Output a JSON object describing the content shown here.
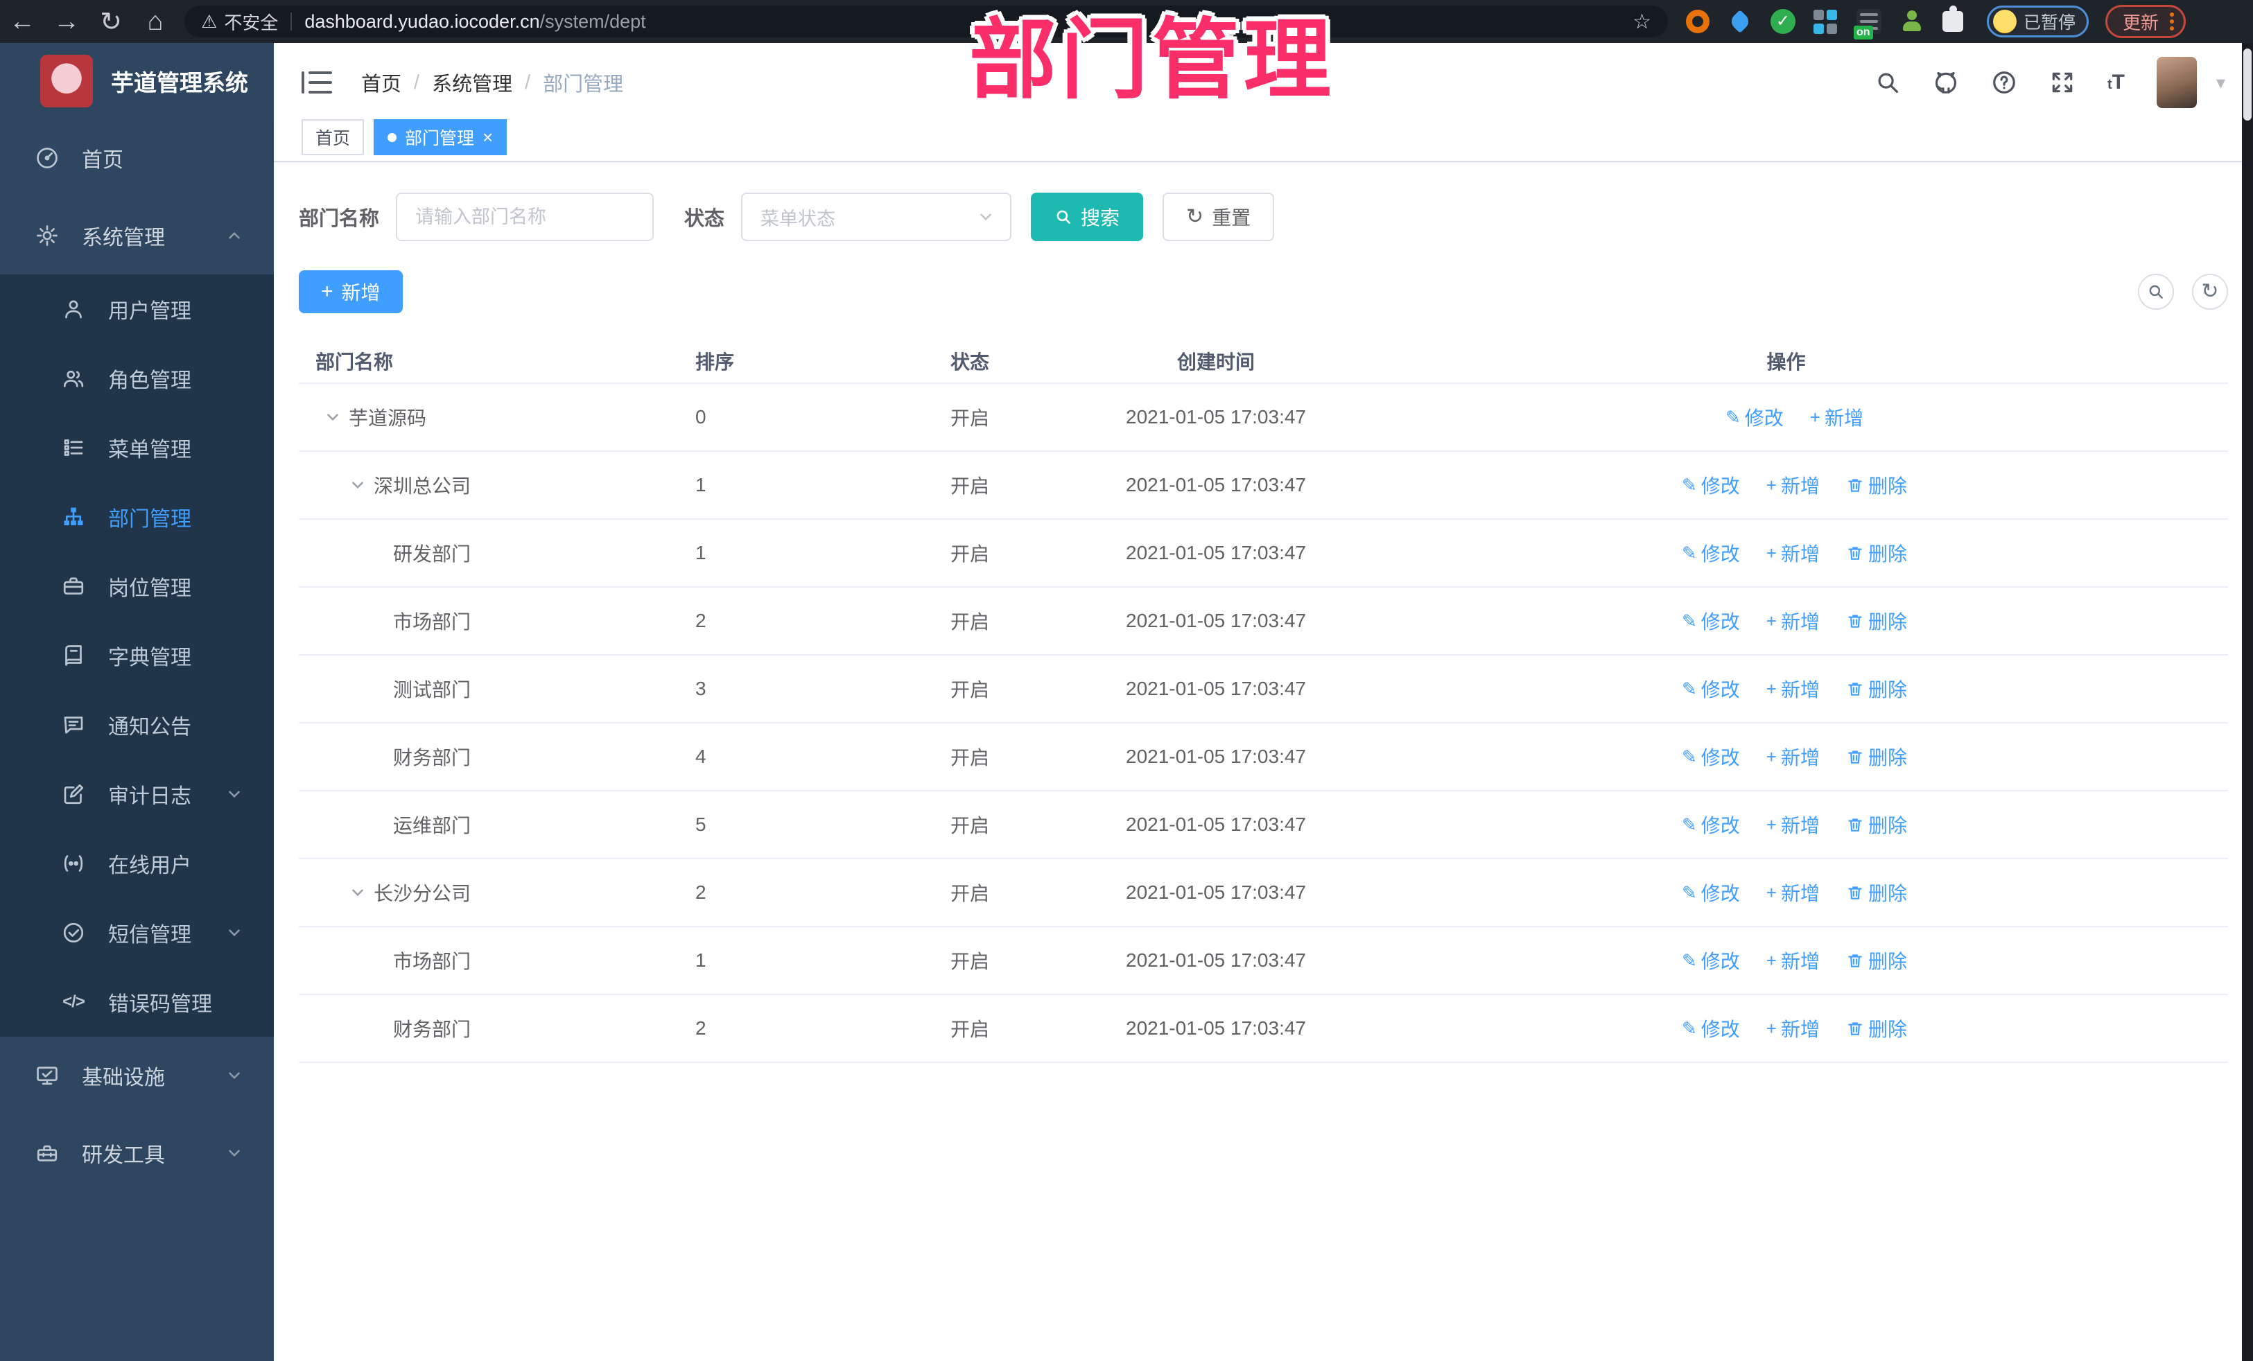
{
  "annotation": {
    "title": "部门管理"
  },
  "browser": {
    "security_label": "不安全",
    "url_host": "dashboard.yudao.iocoder.cn",
    "url_path": "/system/dept",
    "extension_badge": "on",
    "profile_status": "已暂停",
    "update_button": "更新"
  },
  "sidebar": {
    "app_title": "芋道管理系统",
    "items": [
      {
        "label": "首页"
      },
      {
        "label": "系统管理"
      },
      {
        "label": "用户管理"
      },
      {
        "label": "角色管理"
      },
      {
        "label": "菜单管理"
      },
      {
        "label": "部门管理"
      },
      {
        "label": "岗位管理"
      },
      {
        "label": "字典管理"
      },
      {
        "label": "通知公告"
      },
      {
        "label": "审计日志"
      },
      {
        "label": "在线用户"
      },
      {
        "label": "短信管理"
      },
      {
        "label": "错误码管理"
      },
      {
        "label": "基础设施"
      },
      {
        "label": "研发工具"
      }
    ]
  },
  "header": {
    "breadcrumb": [
      {
        "label": "首页"
      },
      {
        "label": "系统管理"
      },
      {
        "label": "部门管理"
      }
    ],
    "separator": "/"
  },
  "tabs": [
    {
      "label": "首页"
    },
    {
      "label": "部门管理"
    }
  ],
  "filter": {
    "name_label": "部门名称",
    "name_placeholder": "请输入部门名称",
    "status_label": "状态",
    "status_placeholder": "菜单状态",
    "search_label": "搜索",
    "reset_label": "重置"
  },
  "toolbar": {
    "add_label": "新增"
  },
  "table": {
    "headers": [
      "部门名称",
      "排序",
      "状态",
      "创建时间",
      "操作"
    ],
    "actions": {
      "modify": "修改",
      "add": "新增",
      "delete": "删除"
    },
    "rows": [
      {
        "name": "芋道源码",
        "sort": "0",
        "status": "开启",
        "time": "2021-01-05 17:03:47"
      },
      {
        "name": "深圳总公司",
        "sort": "1",
        "status": "开启",
        "time": "2021-01-05 17:03:47"
      },
      {
        "name": "研发部门",
        "sort": "1",
        "status": "开启",
        "time": "2021-01-05 17:03:47"
      },
      {
        "name": "市场部门",
        "sort": "2",
        "status": "开启",
        "time": "2021-01-05 17:03:47"
      },
      {
        "name": "测试部门",
        "sort": "3",
        "status": "开启",
        "time": "2021-01-05 17:03:47"
      },
      {
        "name": "财务部门",
        "sort": "4",
        "status": "开启",
        "time": "2021-01-05 17:03:47"
      },
      {
        "name": "运维部门",
        "sort": "5",
        "status": "开启",
        "time": "2021-01-05 17:03:47"
      },
      {
        "name": "长沙分公司",
        "sort": "2",
        "status": "开启",
        "time": "2021-01-05 17:03:47"
      },
      {
        "name": "市场部门",
        "sort": "1",
        "status": "开启",
        "time": "2021-01-05 17:03:47"
      },
      {
        "name": "财务部门",
        "sort": "2",
        "status": "开启",
        "time": "2021-01-05 17:03:47"
      }
    ]
  },
  "colors": {
    "accent": "#409eff",
    "search_teal": "#1eb9b1",
    "annotation_pink": "#fa2f6a",
    "sidebar_bg": "#2e4660",
    "submenu_bg": "#20344a"
  },
  "icons": {
    "back-icon": "←",
    "forward-icon": "→",
    "reload-icon": "↻",
    "home-icon": "⌂",
    "warning-icon": "⚠",
    "bookmark-star-icon": "☆",
    "caret-down-icon": "▾",
    "edit-pencil-icon": "✎",
    "plus-icon": "+",
    "refresh-icon": "↻",
    "search-icon": "svg-magnifier",
    "github-icon": "svg-octocat",
    "help-icon": "svg-question",
    "fullscreen-icon": "svg-expand",
    "font-size-icon": "tT",
    "trash-icon": "svg-trash",
    "chevron-down-icon": "svg-chevron-down",
    "chevron-up-icon": "svg-chevron-up"
  }
}
